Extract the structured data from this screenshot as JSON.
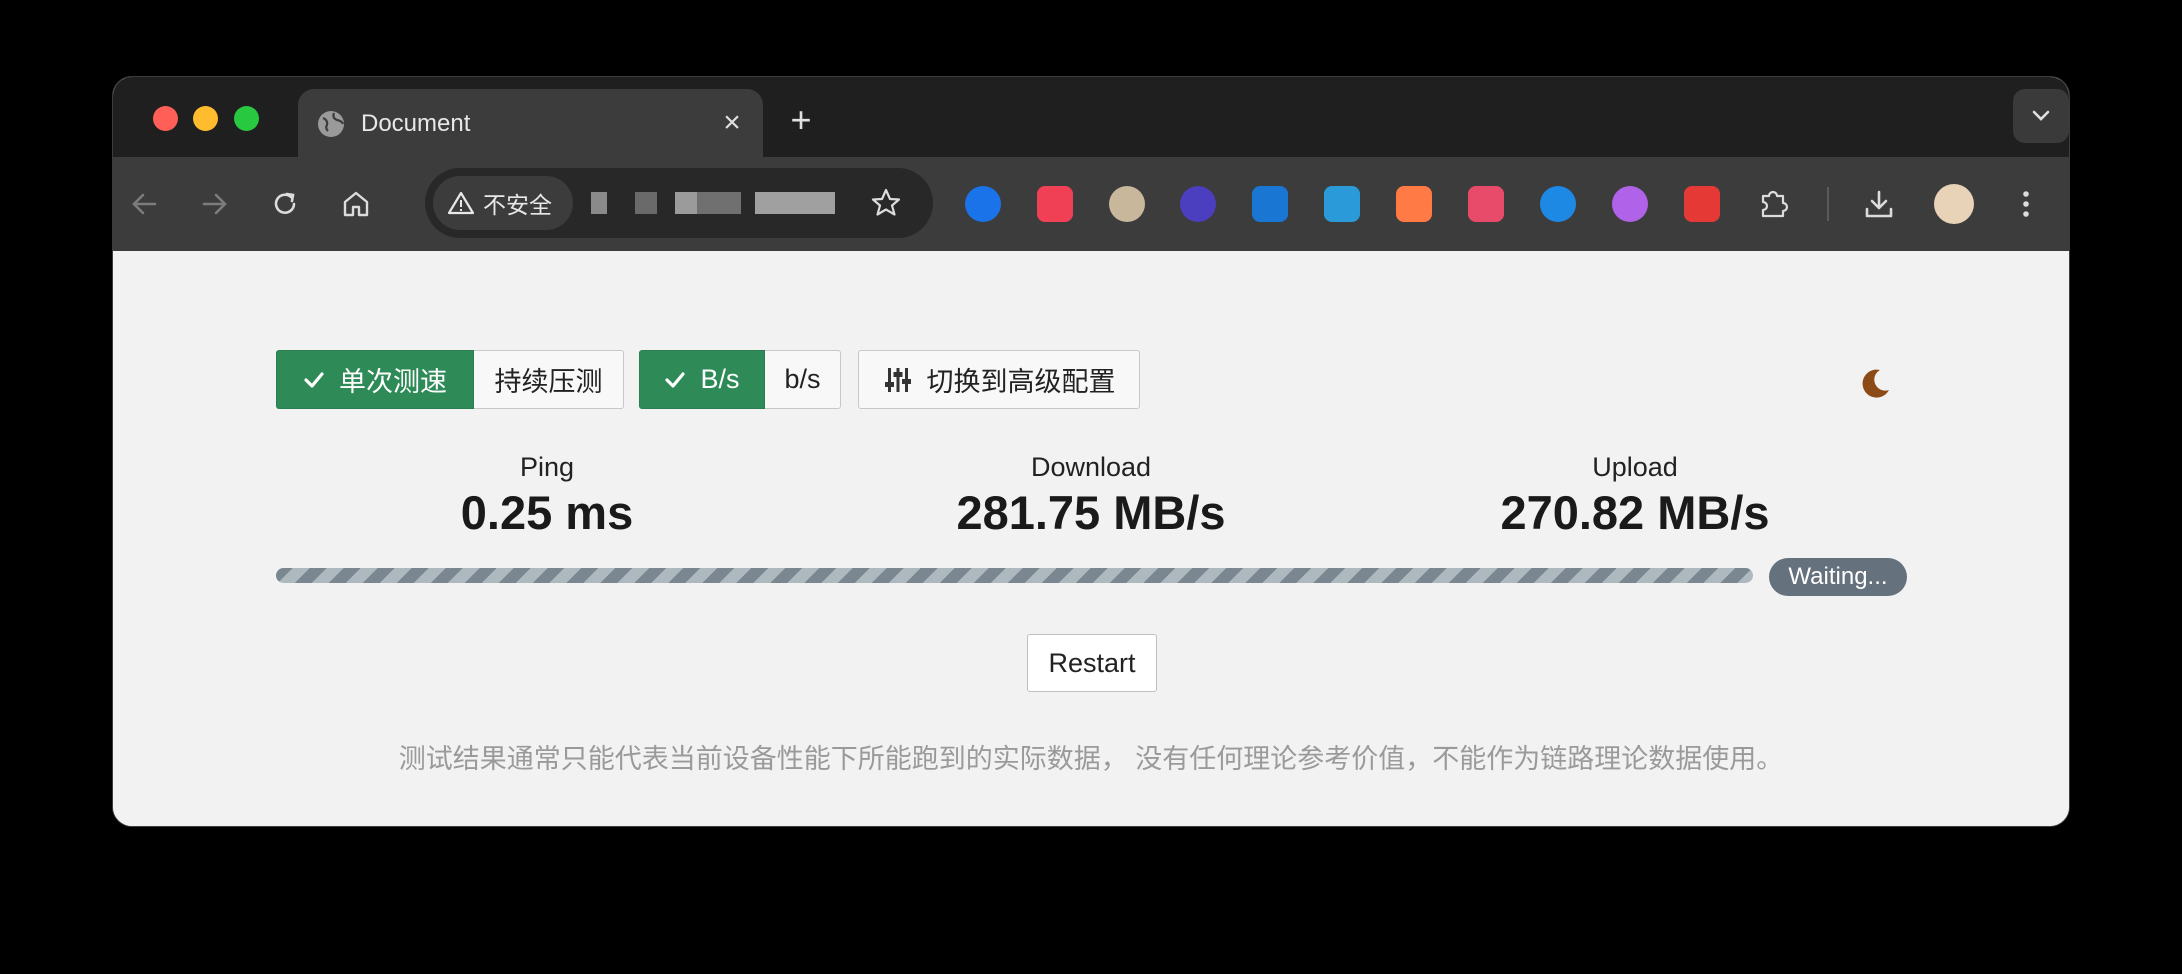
{
  "browser": {
    "tab": {
      "title": "Document",
      "close": "×"
    },
    "new_tab": "+",
    "security_label": "不安全"
  },
  "toolbar": {
    "mode_single": "单次测速",
    "mode_continuous": "持续压测",
    "unit_bytes": "B/s",
    "unit_bits": "b/s",
    "advanced": "切换到高级配置"
  },
  "stats": {
    "ping": {
      "label": "Ping",
      "value": "0.25 ms"
    },
    "download": {
      "label": "Download",
      "value": "281.75 MB/s"
    },
    "upload": {
      "label": "Upload",
      "value": "270.82 MB/s"
    }
  },
  "status": {
    "badge": "Waiting..."
  },
  "actions": {
    "restart": "Restart"
  },
  "note": "测试结果通常只能代表当前设备性能下所能跑到的实际数据， 没有任何理论参考价值，不能作为链路理论数据使用。",
  "colors": {
    "accent_green": "#2e8b57",
    "badge_gray": "#65727e",
    "moon": "#8b4a16"
  }
}
